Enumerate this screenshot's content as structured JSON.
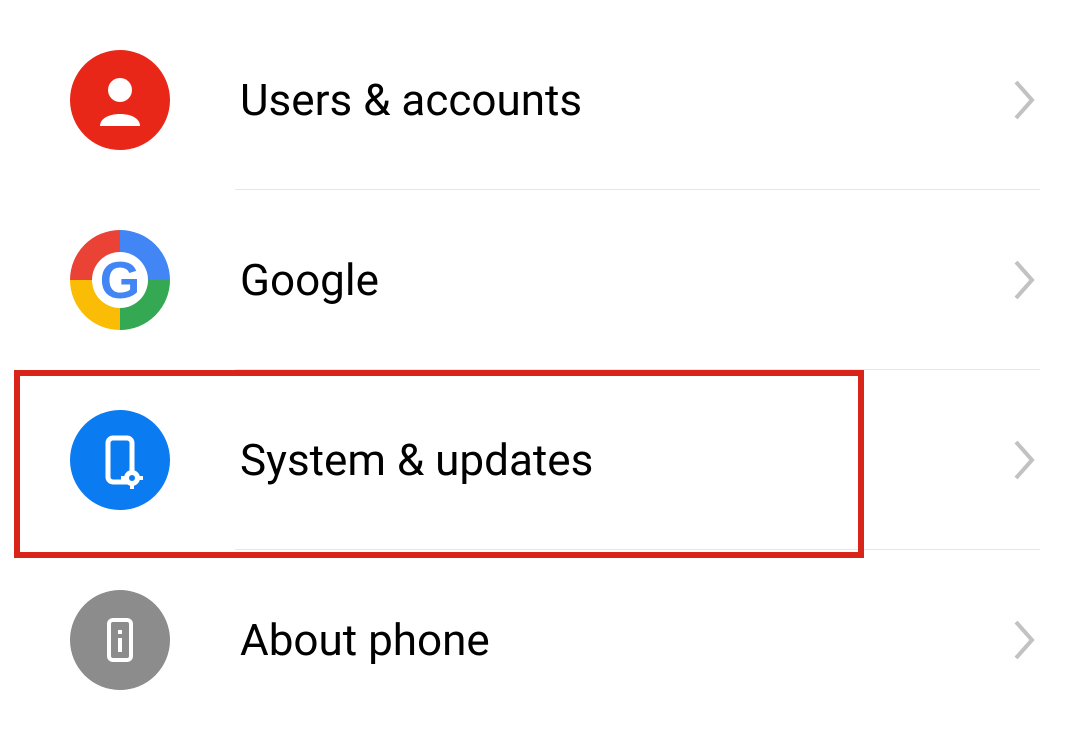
{
  "settings": {
    "items": [
      {
        "label": "Users & accounts",
        "icon": "user-icon"
      },
      {
        "label": "Google",
        "icon": "google-icon"
      },
      {
        "label": "System & updates",
        "icon": "phone-gear-icon"
      },
      {
        "label": "About phone",
        "icon": "phone-info-icon"
      }
    ],
    "highlighted_index": 2
  },
  "colors": {
    "accent_red": "#e92718",
    "accent_blue": "#0b7bf2",
    "icon_gray": "#8c8c8c",
    "highlight_border": "#d9241a"
  }
}
